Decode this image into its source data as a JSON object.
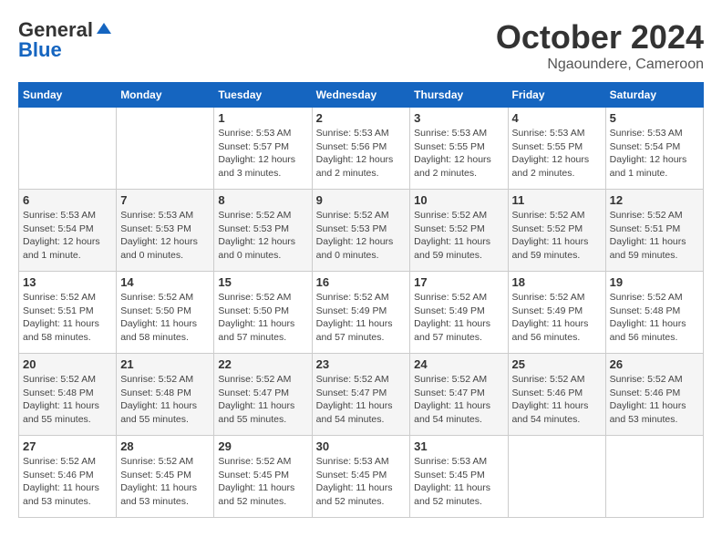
{
  "logo": {
    "general": "General",
    "blue": "Blue"
  },
  "header": {
    "month": "October 2024",
    "location": "Ngaoundere, Cameroon"
  },
  "weekdays": [
    "Sunday",
    "Monday",
    "Tuesday",
    "Wednesday",
    "Thursday",
    "Friday",
    "Saturday"
  ],
  "weeks": [
    [
      null,
      null,
      {
        "day": "1",
        "sunrise": "Sunrise: 5:53 AM",
        "sunset": "Sunset: 5:57 PM",
        "daylight": "Daylight: 12 hours and 3 minutes."
      },
      {
        "day": "2",
        "sunrise": "Sunrise: 5:53 AM",
        "sunset": "Sunset: 5:56 PM",
        "daylight": "Daylight: 12 hours and 2 minutes."
      },
      {
        "day": "3",
        "sunrise": "Sunrise: 5:53 AM",
        "sunset": "Sunset: 5:55 PM",
        "daylight": "Daylight: 12 hours and 2 minutes."
      },
      {
        "day": "4",
        "sunrise": "Sunrise: 5:53 AM",
        "sunset": "Sunset: 5:55 PM",
        "daylight": "Daylight: 12 hours and 2 minutes."
      },
      {
        "day": "5",
        "sunrise": "Sunrise: 5:53 AM",
        "sunset": "Sunset: 5:54 PM",
        "daylight": "Daylight: 12 hours and 1 minute."
      }
    ],
    [
      {
        "day": "6",
        "sunrise": "Sunrise: 5:53 AM",
        "sunset": "Sunset: 5:54 PM",
        "daylight": "Daylight: 12 hours and 1 minute."
      },
      {
        "day": "7",
        "sunrise": "Sunrise: 5:53 AM",
        "sunset": "Sunset: 5:53 PM",
        "daylight": "Daylight: 12 hours and 0 minutes."
      },
      {
        "day": "8",
        "sunrise": "Sunrise: 5:52 AM",
        "sunset": "Sunset: 5:53 PM",
        "daylight": "Daylight: 12 hours and 0 minutes."
      },
      {
        "day": "9",
        "sunrise": "Sunrise: 5:52 AM",
        "sunset": "Sunset: 5:53 PM",
        "daylight": "Daylight: 12 hours and 0 minutes."
      },
      {
        "day": "10",
        "sunrise": "Sunrise: 5:52 AM",
        "sunset": "Sunset: 5:52 PM",
        "daylight": "Daylight: 11 hours and 59 minutes."
      },
      {
        "day": "11",
        "sunrise": "Sunrise: 5:52 AM",
        "sunset": "Sunset: 5:52 PM",
        "daylight": "Daylight: 11 hours and 59 minutes."
      },
      {
        "day": "12",
        "sunrise": "Sunrise: 5:52 AM",
        "sunset": "Sunset: 5:51 PM",
        "daylight": "Daylight: 11 hours and 59 minutes."
      }
    ],
    [
      {
        "day": "13",
        "sunrise": "Sunrise: 5:52 AM",
        "sunset": "Sunset: 5:51 PM",
        "daylight": "Daylight: 11 hours and 58 minutes."
      },
      {
        "day": "14",
        "sunrise": "Sunrise: 5:52 AM",
        "sunset": "Sunset: 5:50 PM",
        "daylight": "Daylight: 11 hours and 58 minutes."
      },
      {
        "day": "15",
        "sunrise": "Sunrise: 5:52 AM",
        "sunset": "Sunset: 5:50 PM",
        "daylight": "Daylight: 11 hours and 57 minutes."
      },
      {
        "day": "16",
        "sunrise": "Sunrise: 5:52 AM",
        "sunset": "Sunset: 5:49 PM",
        "daylight": "Daylight: 11 hours and 57 minutes."
      },
      {
        "day": "17",
        "sunrise": "Sunrise: 5:52 AM",
        "sunset": "Sunset: 5:49 PM",
        "daylight": "Daylight: 11 hours and 57 minutes."
      },
      {
        "day": "18",
        "sunrise": "Sunrise: 5:52 AM",
        "sunset": "Sunset: 5:49 PM",
        "daylight": "Daylight: 11 hours and 56 minutes."
      },
      {
        "day": "19",
        "sunrise": "Sunrise: 5:52 AM",
        "sunset": "Sunset: 5:48 PM",
        "daylight": "Daylight: 11 hours and 56 minutes."
      }
    ],
    [
      {
        "day": "20",
        "sunrise": "Sunrise: 5:52 AM",
        "sunset": "Sunset: 5:48 PM",
        "daylight": "Daylight: 11 hours and 55 minutes."
      },
      {
        "day": "21",
        "sunrise": "Sunrise: 5:52 AM",
        "sunset": "Sunset: 5:48 PM",
        "daylight": "Daylight: 11 hours and 55 minutes."
      },
      {
        "day": "22",
        "sunrise": "Sunrise: 5:52 AM",
        "sunset": "Sunset: 5:47 PM",
        "daylight": "Daylight: 11 hours and 55 minutes."
      },
      {
        "day": "23",
        "sunrise": "Sunrise: 5:52 AM",
        "sunset": "Sunset: 5:47 PM",
        "daylight": "Daylight: 11 hours and 54 minutes."
      },
      {
        "day": "24",
        "sunrise": "Sunrise: 5:52 AM",
        "sunset": "Sunset: 5:47 PM",
        "daylight": "Daylight: 11 hours and 54 minutes."
      },
      {
        "day": "25",
        "sunrise": "Sunrise: 5:52 AM",
        "sunset": "Sunset: 5:46 PM",
        "daylight": "Daylight: 11 hours and 54 minutes."
      },
      {
        "day": "26",
        "sunrise": "Sunrise: 5:52 AM",
        "sunset": "Sunset: 5:46 PM",
        "daylight": "Daylight: 11 hours and 53 minutes."
      }
    ],
    [
      {
        "day": "27",
        "sunrise": "Sunrise: 5:52 AM",
        "sunset": "Sunset: 5:46 PM",
        "daylight": "Daylight: 11 hours and 53 minutes."
      },
      {
        "day": "28",
        "sunrise": "Sunrise: 5:52 AM",
        "sunset": "Sunset: 5:45 PM",
        "daylight": "Daylight: 11 hours and 53 minutes."
      },
      {
        "day": "29",
        "sunrise": "Sunrise: 5:52 AM",
        "sunset": "Sunset: 5:45 PM",
        "daylight": "Daylight: 11 hours and 52 minutes."
      },
      {
        "day": "30",
        "sunrise": "Sunrise: 5:53 AM",
        "sunset": "Sunset: 5:45 PM",
        "daylight": "Daylight: 11 hours and 52 minutes."
      },
      {
        "day": "31",
        "sunrise": "Sunrise: 5:53 AM",
        "sunset": "Sunset: 5:45 PM",
        "daylight": "Daylight: 11 hours and 52 minutes."
      },
      null,
      null
    ]
  ]
}
